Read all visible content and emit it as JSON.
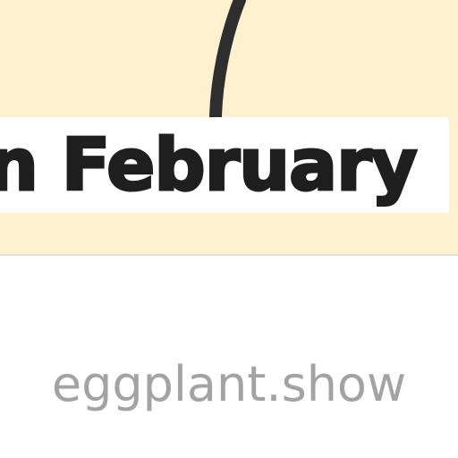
{
  "card": {
    "headline": "on February",
    "background_color": "#fdf1cf",
    "text_color": "#1f1f1f"
  },
  "footer": {
    "site_domain": "eggplant.show",
    "domain_color": "#a3a3a3"
  }
}
